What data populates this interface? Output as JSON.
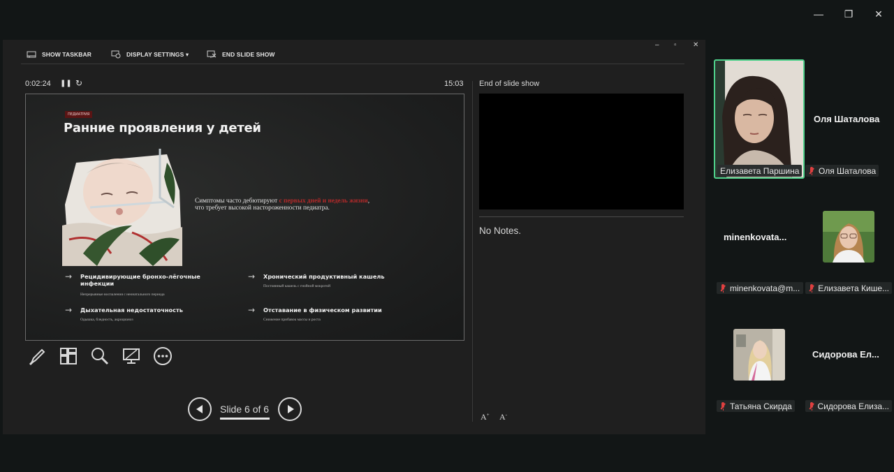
{
  "window": {
    "minimize_glyph": "—",
    "restore_glyph": "❐",
    "close_glyph": "✕"
  },
  "toolbar": {
    "show_taskbar": "SHOW TASKBAR",
    "display_settings": "DISPLAY SETTINGS ▾",
    "end_slide_show": "END SLIDE SHOW",
    "mini_min": "–",
    "mini_restore": "▫",
    "mini_close": "✕"
  },
  "presenter": {
    "elapsed": "0:02:24",
    "pause_glyph": "❚❚",
    "restart_glyph": "↻",
    "clock": "15:03",
    "next_label": "End of slide show",
    "notes": "No Notes.",
    "slide_counter": "Slide 6 of 6",
    "font_increase": "A",
    "font_decrease": "A"
  },
  "slide": {
    "tag": "ПЕДИАТРИЯ",
    "title": "Ранние проявления у детей",
    "body_prefix": "Симптомы часто дебютируют ",
    "body_highlight": "с первых дней и недель жизни",
    "body_suffix": ",",
    "body_line2": "что требует высокой настороженности педиатра.",
    "features": [
      {
        "title": "Рецидивирующие бронхо-лёгочные инфекции",
        "sub": "Непрерывные воспаления с неонатального периода"
      },
      {
        "title": "Хронический продуктивный кашель",
        "sub": "Постоянный кашель с гнойной мокротой"
      },
      {
        "title": "Дыхательная недостаточность",
        "sub": "Одышка, бледность, акроцианоз"
      },
      {
        "title": "Отставание в физическом развитии",
        "sub": "Снижение прибавок массы и роста"
      }
    ],
    "arrow_glyph": "→"
  },
  "participants": [
    {
      "tile_name": "",
      "label": "Елизавета Паршина",
      "active": true
    },
    {
      "tile_name": "Оля Шаталова",
      "label": "Оля Шаталова"
    },
    {
      "tile_name": "minenkovata...",
      "label": "minenkovata@m..."
    },
    {
      "tile_name": "",
      "label": "Елизавета Кише..."
    },
    {
      "tile_name": "",
      "label": "Татьяна Скирда"
    },
    {
      "tile_name": "Сидорова  Ел...",
      "label": "Сидорова Елиза..."
    }
  ],
  "colors": {
    "active_speaker_border": "#4fd18b",
    "accent_red": "#b42a2a",
    "mic_muted": "#e04040"
  }
}
